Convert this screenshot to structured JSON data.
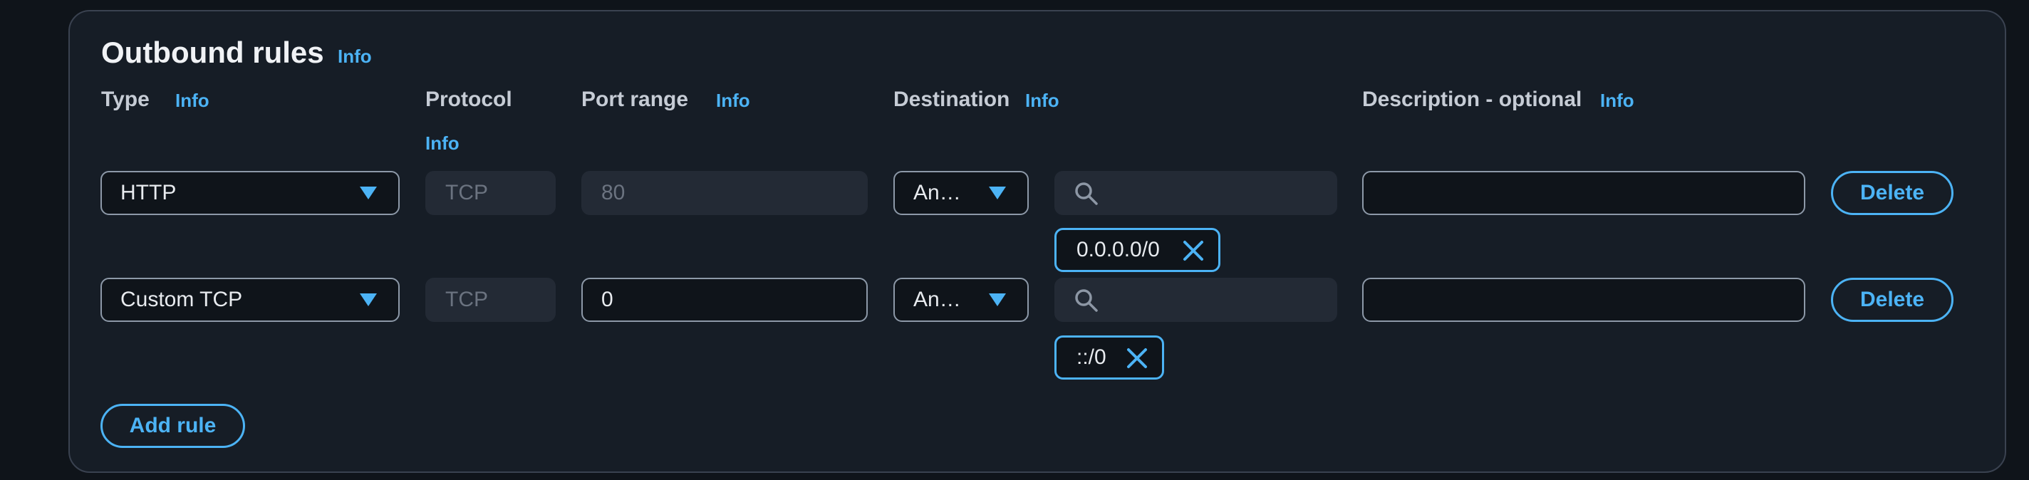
{
  "section": {
    "title": "Outbound rules",
    "title_info": "Info"
  },
  "columns": {
    "type": {
      "label": "Type",
      "info": "Info"
    },
    "protocol": {
      "label": "Protocol",
      "info": "Info"
    },
    "port_range": {
      "label": "Port range",
      "info": "Info"
    },
    "destination": {
      "label": "Destination",
      "info": "Info"
    },
    "description": {
      "label": "Description - optional",
      "info": "Info"
    }
  },
  "rules": [
    {
      "type": "HTTP",
      "protocol": "TCP",
      "port_range": "80",
      "port_editable": false,
      "destination_type": "An…",
      "destination_search": "",
      "destination_token": "0.0.0.0/0",
      "description": "",
      "delete_label": "Delete"
    },
    {
      "type": "Custom TCP",
      "protocol": "TCP",
      "port_range": "0",
      "port_editable": true,
      "destination_type": "An…",
      "destination_search": "",
      "destination_token": "::/0",
      "description": "",
      "delete_label": "Delete"
    }
  ],
  "add_rule_label": "Add rule",
  "colors": {
    "accent": "#4cb3f5",
    "panel_bg": "#161d26",
    "page_bg": "#0f141a",
    "disabled_bg": "#232a35"
  },
  "icons": {
    "dropdown": "caret-down-icon",
    "search": "search-icon",
    "remove": "close-icon"
  }
}
